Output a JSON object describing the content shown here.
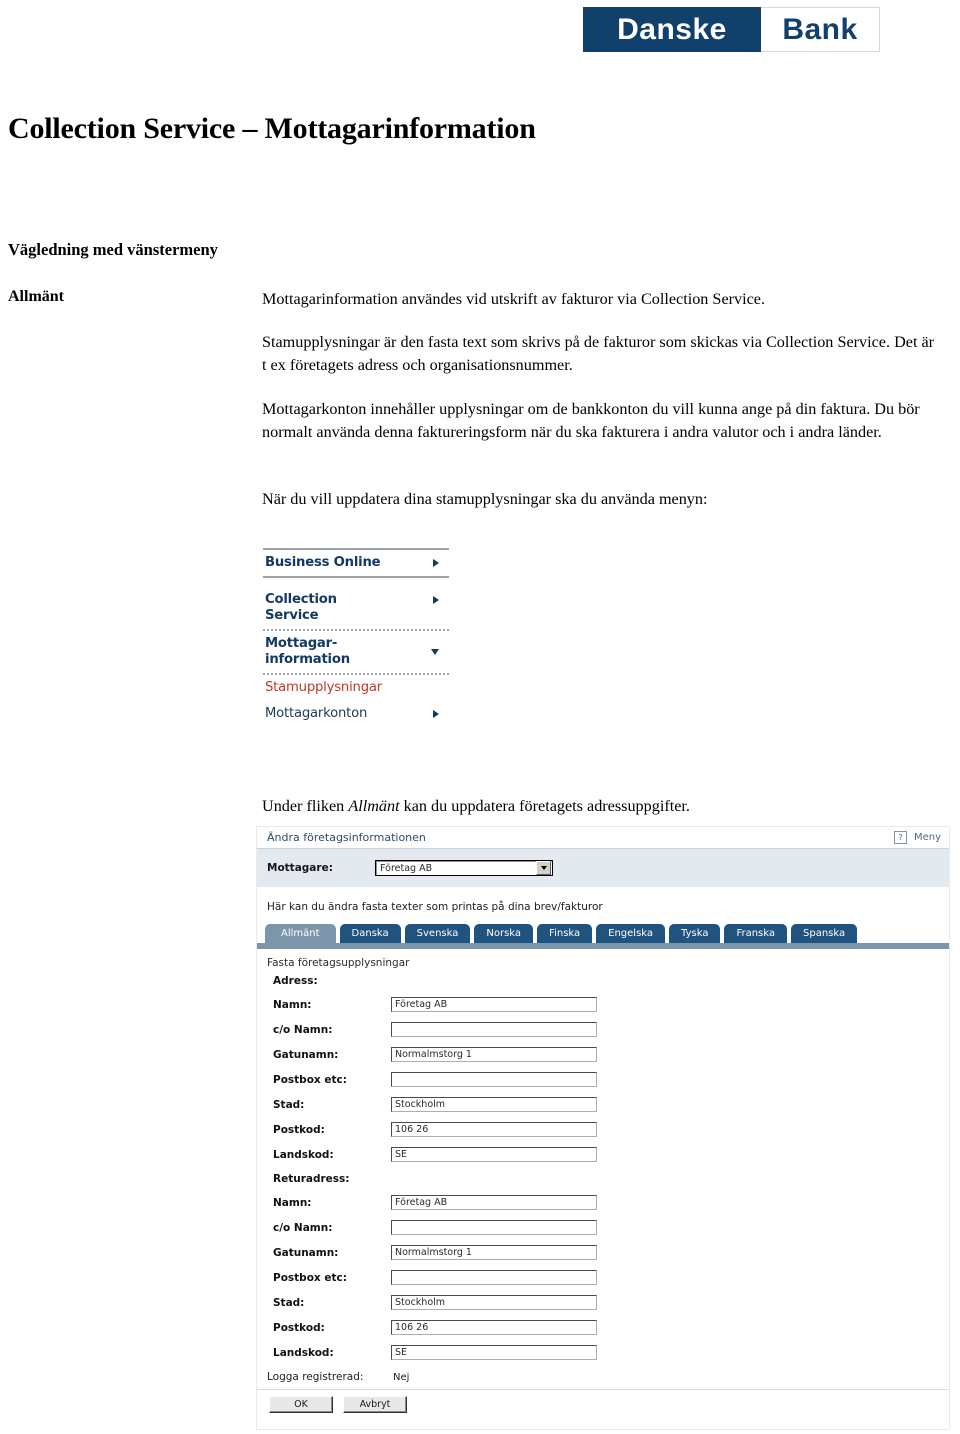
{
  "logo": {
    "left_word": "Danske",
    "right_word": "Bank",
    "dark_blue": "#10406b"
  },
  "document": {
    "title": "Collection Service – Mottagarinformation",
    "subheading": "Vägledning med vänstermeny",
    "section_label": "Allmänt",
    "paragraphs": {
      "p1": "Mottagarinformation användes vid utskrift av fakturor via Collection Service.",
      "p2": "Stamupplysningar är den fasta text som skrivs på de fakturor som skickas via Collection Service. Det är t ex företagets adress och organisationsnummer.",
      "p3": "Mottagarkonton innehåller upplysningar om de bankkonton du vill kunna ange på din faktura. Du bör normalt använda denna faktureringsform när du ska fakturera i andra valutor och i andra länder.",
      "p4": "När du vill uppdatera dina stamupplysningar ska du använda menyn:",
      "p5_before": "Under fliken ",
      "p5_italic": "Allmänt",
      "p5_after": " kan du uppdatera företagets adressuppgifter."
    }
  },
  "left_menu": {
    "items": [
      {
        "label": "Business Online",
        "arrow": "chevron-right-icon",
        "style": "bold-navy"
      },
      {
        "label_line1": "Collection",
        "label_line2": "Service",
        "arrow": "chevron-right-icon",
        "style": "bold-navy"
      },
      {
        "label_line1": "Mottagar-",
        "label_line2": "information",
        "arrow": "chevron-down-icon",
        "style": "bold-navy"
      },
      {
        "label": "Stamupplysningar",
        "arrow": "none",
        "style": "red"
      },
      {
        "label": "Mottagarkonton",
        "arrow": "chevron-right-icon",
        "style": "navy"
      }
    ],
    "colors": {
      "navy": "#123a63",
      "red": "#c0392b",
      "rule": "#9aa4ad"
    }
  },
  "app": {
    "title": "Ändra företagsinformationen",
    "help_icon": "question-mark-icon",
    "menu_link": "Meny",
    "recipient": {
      "label": "Mottagare:",
      "selected": "Företag AB"
    },
    "hint": "Här kan du ändra fasta texter som printas på dina brev/fakturor",
    "tabs": [
      {
        "label": "Allmänt",
        "active": true
      },
      {
        "label": "Danska",
        "active": false
      },
      {
        "label": "Svenska",
        "active": false
      },
      {
        "label": "Norska",
        "active": false
      },
      {
        "label": "Finska",
        "active": false
      },
      {
        "label": "Engelska",
        "active": false
      },
      {
        "label": "Tyska",
        "active": false
      },
      {
        "label": "Franska",
        "active": false
      },
      {
        "label": "Spanska",
        "active": false
      }
    ],
    "group_title": "Fasta företagsupplysningar",
    "address_section": {
      "title": "Adress:",
      "fields": [
        {
          "label": "Namn:",
          "value": "Företag AB"
        },
        {
          "label": "c/o Namn:",
          "value": ""
        },
        {
          "label": "Gatunamn:",
          "value": "Normalmstorg 1"
        },
        {
          "label": "Postbox etc:",
          "value": ""
        },
        {
          "label": "Stad:",
          "value": "Stockholm"
        },
        {
          "label": "Postkod:",
          "value": "106 26"
        },
        {
          "label": "Landskod:",
          "value": "SE"
        }
      ]
    },
    "return_section": {
      "title": "Returadress:",
      "fields": [
        {
          "label": "Namn:",
          "value": "Företag AB"
        },
        {
          "label": "c/o Namn:",
          "value": ""
        },
        {
          "label": "Gatunamn:",
          "value": "Normalmstorg 1"
        },
        {
          "label": "Postbox etc:",
          "value": ""
        },
        {
          "label": "Stad:",
          "value": "Stockholm"
        },
        {
          "label": "Postkod:",
          "value": "106 26"
        },
        {
          "label": "Landskod:",
          "value": "SE"
        }
      ]
    },
    "logo_registered": {
      "label": "Logga registrerad:",
      "value": "Nej"
    },
    "buttons": {
      "ok": "OK",
      "cancel": "Avbryt"
    },
    "colors": {
      "tab_active": "#7b95ab",
      "tab_inactive": "#20537f",
      "recipient_bg": "#e3e9ee",
      "title_color": "#2e4d69"
    }
  }
}
